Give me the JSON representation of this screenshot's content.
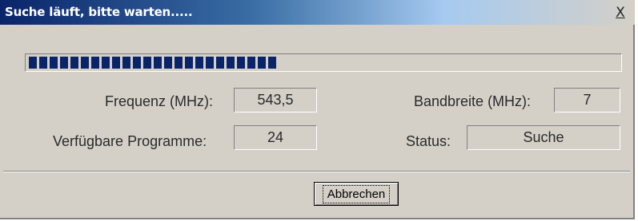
{
  "dialog": {
    "title": "Suche läuft, bitte warten.....",
    "close_label": "X",
    "progress_fraction": 0.43,
    "frequency": {
      "label": "Frequenz (MHz):",
      "value": "543,5"
    },
    "bandwidth": {
      "label": "Bandbreite (MHz):",
      "value": "7"
    },
    "programs": {
      "label": "Verfügbare Programme:",
      "value": "24"
    },
    "status": {
      "label": "Status:",
      "value": "Suche"
    },
    "cancel_label": "Abbrechen"
  },
  "colors": {
    "title_gradient_start": "#0a246a",
    "progress_block": "#0a246a",
    "dialog_face": "#d4d0c8"
  }
}
